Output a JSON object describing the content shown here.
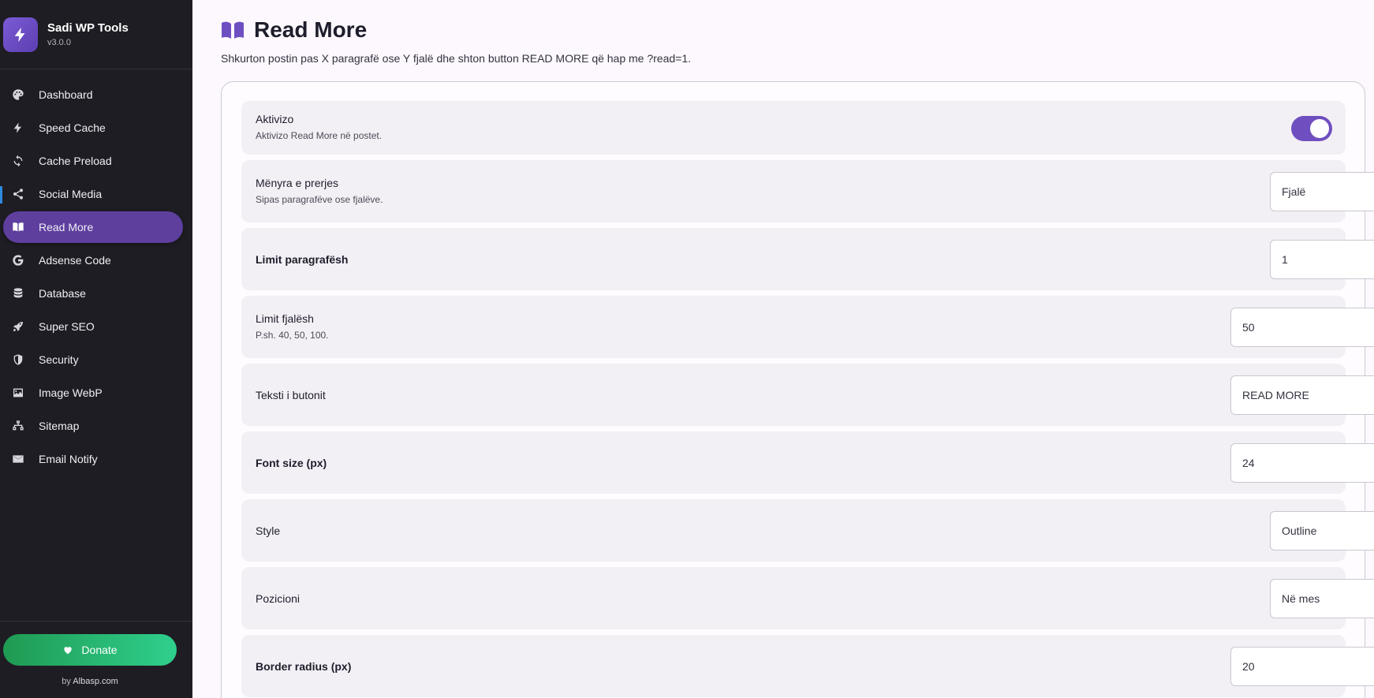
{
  "brand": {
    "title": "Sadi WP Tools",
    "version": "v3.0.0"
  },
  "sidebar": {
    "items": [
      {
        "label": "Dashboard",
        "icon": "palette-icon"
      },
      {
        "label": "Speed Cache",
        "icon": "bolt-icon"
      },
      {
        "label": "Cache Preload",
        "icon": "sync-icon"
      },
      {
        "label": "Social Media",
        "icon": "share-icon"
      },
      {
        "label": "Read More",
        "icon": "book-icon",
        "active": true
      },
      {
        "label": "Adsense Code",
        "icon": "google-icon"
      },
      {
        "label": "Database",
        "icon": "database-icon"
      },
      {
        "label": "Super SEO",
        "icon": "rocket-icon"
      },
      {
        "label": "Security",
        "icon": "shield-icon"
      },
      {
        "label": "Image WebP",
        "icon": "image-icon"
      },
      {
        "label": "Sitemap",
        "icon": "sitemap-icon"
      },
      {
        "label": "Email Notify",
        "icon": "envelope-icon"
      }
    ],
    "donate_label": "Donate",
    "by_prefix": "by",
    "by_link": "Albasp.com"
  },
  "page": {
    "title": "Read More",
    "subtitle": "Shkurton postin pas X paragrafë ose Y fjalë dhe shton button READ MORE që hap me ?read=1."
  },
  "settings": {
    "activate": {
      "label": "Aktivizo",
      "desc": "Aktivizo Read More në postet.",
      "enabled": true
    },
    "mode": {
      "label": "Mënyra e prerjes",
      "desc": "Sipas paragrafëve ose fjalëve.",
      "value": "Fjalë"
    },
    "paragraph_limit": {
      "label": "Limit paragrafësh",
      "value": "1"
    },
    "word_limit": {
      "label": "Limit fjalësh",
      "desc": "P.sh. 40, 50, 100.",
      "value": "50"
    },
    "button_text": {
      "label": "Teksti i butonit",
      "value": "READ MORE"
    },
    "font_size": {
      "label": "Font size (px)",
      "value": "24"
    },
    "style": {
      "label": "Style",
      "value": "Outline"
    },
    "position": {
      "label": "Pozicioni",
      "value": "Në mes"
    },
    "border_radius": {
      "label": "Border radius (px)",
      "value": "20"
    }
  },
  "colors": {
    "accent": "#6f4fbf",
    "sidebar_bg": "#1e1d23",
    "donate": "#2fcf8d"
  }
}
